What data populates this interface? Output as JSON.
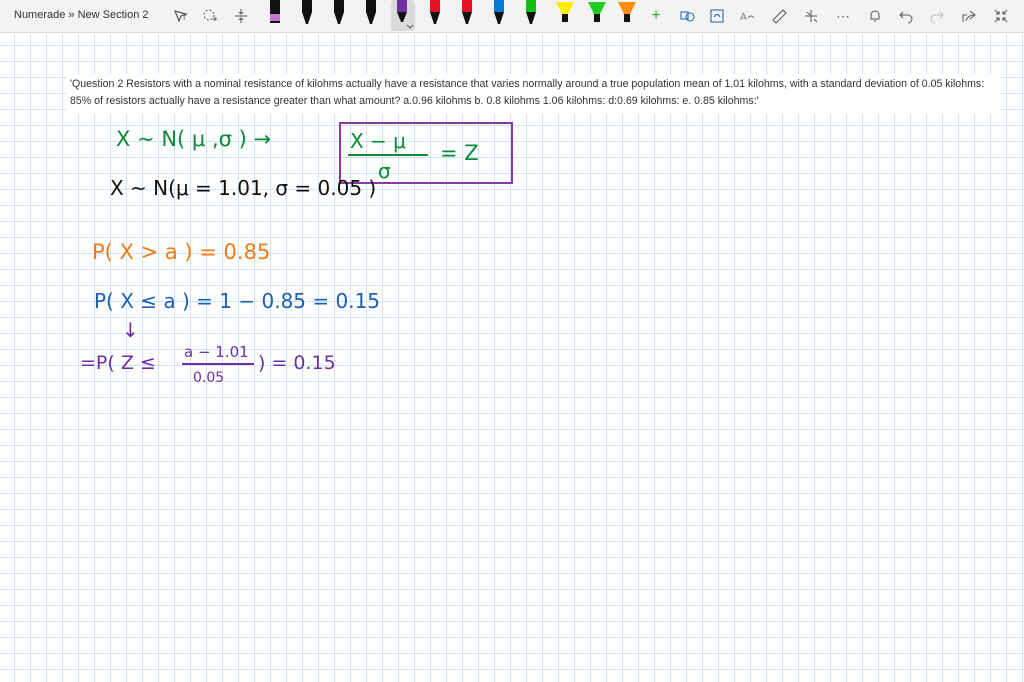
{
  "breadcrumb": "Numerade » New Section 2",
  "toolbar": {
    "icons": [
      "lasso-select-icon",
      "add-space-icon",
      "insert-space-icon"
    ],
    "pens": [
      {
        "color": "#c774d4",
        "name": "pink-highlighter"
      },
      {
        "color": "#000000",
        "name": "black-pen"
      },
      {
        "color": "#000000",
        "name": "black-pen-2"
      },
      {
        "color": "#000000",
        "name": "black-pen-3"
      },
      {
        "color": "#7030a0",
        "name": "purple-pen"
      },
      {
        "color": "#e81123",
        "name": "red-pen"
      },
      {
        "color": "#e81123",
        "name": "red-pen-2"
      },
      {
        "color": "#0078d4",
        "name": "blue-pen"
      },
      {
        "color": "#10c010",
        "name": "green-pen"
      },
      {
        "color": "#ffee00",
        "name": "yellow-highlighter"
      },
      {
        "color": "#22cc22",
        "name": "green-highlighter"
      },
      {
        "color": "#00d0f0",
        "name": "cyan-highlighter"
      },
      {
        "color": "#ff8c00",
        "name": "orange-highlighter"
      }
    ],
    "add_pen": "+"
  },
  "question_text": "'Question 2 Resistors with a nominal resistance of kilohms actually have a resistance that varies normally around a true population mean of 1.01 kilohms, with a standard deviation of 0.05 kilohms: 85% of resistors actually have a resistance greater than what amount? a.0.96 kilohms b. 0.8 kilohms 1.06 kilohms: d:0.69 kilohms: e. 0.85 kilohms:'",
  "ink": {
    "line1_left": "X ~ N( μ ,σ ) →",
    "line1_frac_num": "X − μ",
    "line1_frac_den": "σ",
    "line1_eq": "= Z",
    "line2": "X ~  N(μ = 1.01, σ = 0.05 )",
    "line3": "P( X > a )  =  0.85",
    "line4": "P( X ≤ a )  =  1 − 0.85 = 0.15",
    "arrow": "↓",
    "line5_left": "=P( Z ≤",
    "line5_num": "a − 1.01",
    "line5_den": "0.05",
    "line5_right": ")  =  0.15",
    "colors": {
      "green": "#0a8a3a",
      "black": "#111111",
      "orange": "#f07a14",
      "blue": "#1a5fb4",
      "purple": "#6b2fa3"
    }
  }
}
